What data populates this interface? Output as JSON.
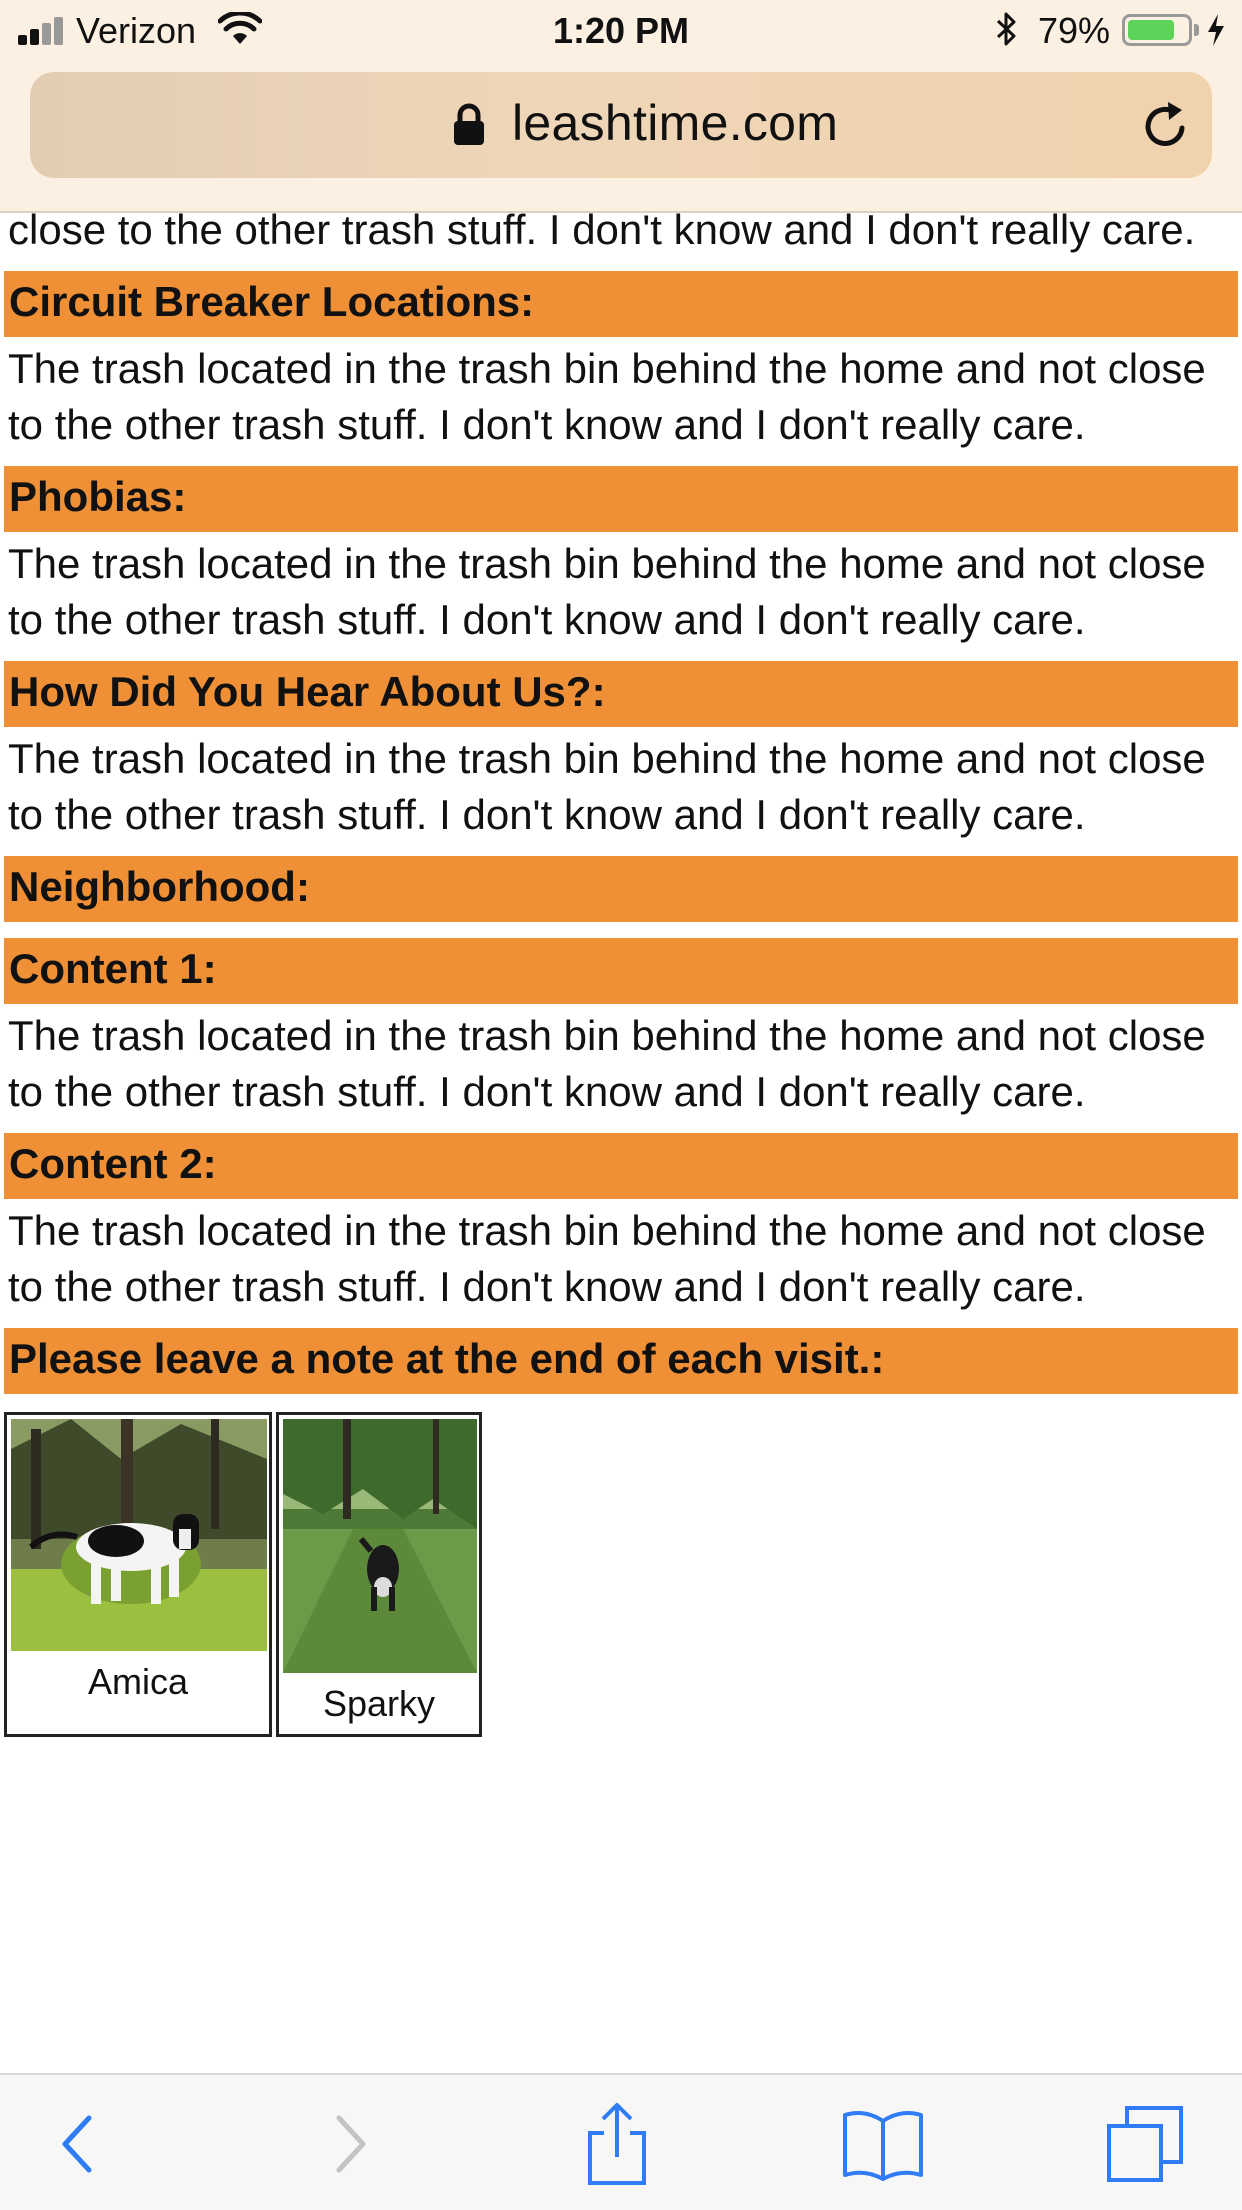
{
  "status_bar": {
    "carrier": "Verizon",
    "time": "1:20 PM",
    "battery_percent": "79%",
    "battery_level": 0.79,
    "icons": [
      "signal-icon",
      "wifi-icon",
      "bluetooth-icon",
      "battery-icon",
      "charging-icon"
    ]
  },
  "address_bar": {
    "url": "leashtime.com",
    "icons": [
      "lock-icon",
      "reload-icon"
    ]
  },
  "page": {
    "top_partial_text": "close to the other trash stuff. I don't know and I don't really care.",
    "sections": [
      {
        "label": "Circuit Breaker Locations:",
        "text": "The trash located in the trash bin behind the home and not close to the other trash stuff. I don't know and I don't really care."
      },
      {
        "label": "Phobias:",
        "text": "The trash located in the trash bin behind the home and not close to the other trash stuff. I don't know and I don't really care."
      },
      {
        "label": "How Did You Hear About Us?:",
        "text": "The trash located in the trash bin behind the home and not close to the other trash stuff. I don't know and I don't really care."
      },
      {
        "label": "Neighborhood:",
        "text": ""
      },
      {
        "label": "Content 1:",
        "text": "The trash located in the trash bin behind the home and not close to the other trash stuff. I don't know and I don't really care."
      },
      {
        "label": "Content 2:",
        "text": "The trash located in the trash bin behind the home and not close to the other trash stuff. I don't know and I don't really care."
      },
      {
        "label": "Please leave a note at the end of each visit.:",
        "text": ""
      }
    ],
    "pets": [
      {
        "name": "Amica"
      },
      {
        "name": "Sparky"
      }
    ]
  },
  "toolbar": {
    "icons": [
      "back-icon",
      "forward-icon",
      "share-icon",
      "bookmarks-icon",
      "tabs-icon"
    ]
  },
  "colors": {
    "label_bg": "#ef9036",
    "ios_blue": "#2f7cf6",
    "chrome_bg": "#fbf0e2"
  }
}
